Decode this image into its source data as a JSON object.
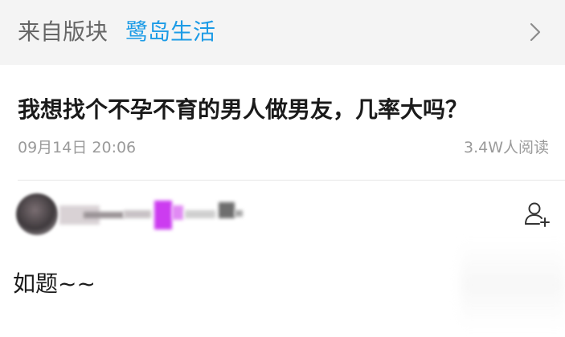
{
  "section": {
    "prefix": "来自版块",
    "name": "鹭岛生活",
    "chevron_icon": "chevron-right-icon",
    "name_color": "#1c9be6"
  },
  "post": {
    "title": "我想找个不孕不育的男人做男友，几率大吗？",
    "date": "09月14日 20:06",
    "views": "3.4W人阅读",
    "body": "如题~~"
  },
  "author": {
    "avatar_icon": "avatar",
    "follow_icon": "follow-user-icon"
  }
}
